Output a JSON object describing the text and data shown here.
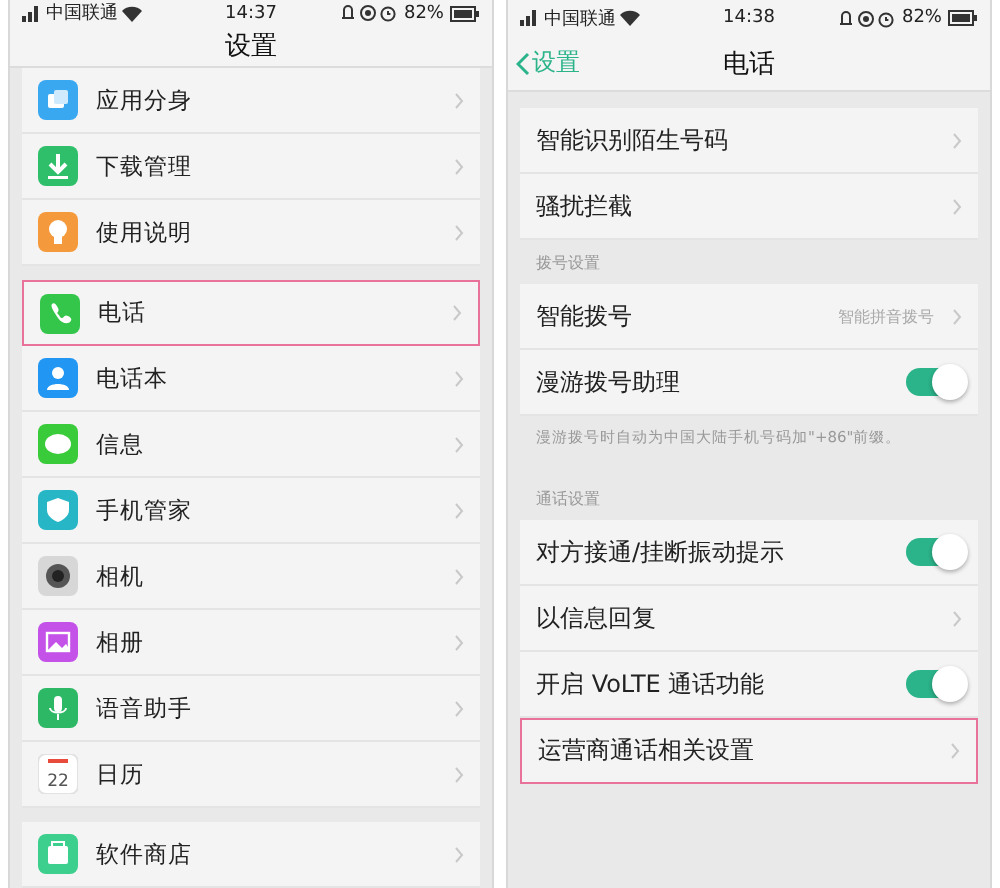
{
  "screens": [
    {
      "status_bar": {
        "carrier": "中国联通",
        "time": "14:37",
        "battery": "82%"
      },
      "header": {
        "title": "设置"
      },
      "sections": [
        {
          "rows": [
            {
              "kind": "app",
              "label": "应用分身",
              "highlighted": false
            },
            {
              "kind": "app",
              "label": "下载管理",
              "highlighted": false
            },
            {
              "kind": "app",
              "label": "使用说明",
              "highlighted": false
            }
          ]
        },
        {
          "rows": [
            {
              "kind": "app",
              "label": "电话",
              "highlighted": true
            },
            {
              "kind": "app",
              "label": "电话本",
              "highlighted": false
            },
            {
              "kind": "app",
              "label": "信息",
              "highlighted": false
            },
            {
              "kind": "app",
              "label": "手机管家",
              "highlighted": false
            },
            {
              "kind": "app",
              "label": "相机",
              "highlighted": false
            },
            {
              "kind": "app",
              "label": "相册",
              "highlighted": false
            },
            {
              "kind": "app",
              "label": "语音助手",
              "highlighted": false
            },
            {
              "kind": "app",
              "icon_text": "22",
              "label": "日历",
              "highlighted": false
            }
          ]
        },
        {
          "rows": [
            {
              "kind": "app",
              "label": "软件商店",
              "highlighted": false
            }
          ]
        }
      ]
    },
    {
      "status_bar": {
        "carrier": "中国联通",
        "time": "14:38",
        "battery": "82%"
      },
      "header": {
        "title": "电话",
        "back": "设置"
      },
      "sections": [
        {
          "rows": [
            {
              "kind": "link",
              "label": "智能识别陌生号码",
              "highlighted": false
            },
            {
              "kind": "link",
              "label": "骚扰拦截",
              "highlighted": false
            }
          ]
        },
        {
          "label": "拨号设置",
          "rows": [
            {
              "kind": "value",
              "label": "智能拨号",
              "value": "智能拼音拨号",
              "highlighted": false
            },
            {
              "kind": "toggle",
              "label": "漫游拨号助理",
              "on": true,
              "highlighted": false
            }
          ],
          "note": "漫游拨号时自动为中国大陆手机号码加\"+86\"前缀。"
        },
        {
          "label": "通话设置",
          "rows": [
            {
              "kind": "toggle",
              "label": "对方接通/挂断振动提示",
              "on": true,
              "highlighted": false
            },
            {
              "kind": "link",
              "label": "以信息回复",
              "highlighted": false
            },
            {
              "kind": "toggle",
              "label": "开启 VoLTE 通话功能",
              "on": true,
              "highlighted": false
            },
            {
              "kind": "link",
              "label": "运营商通话相关设置",
              "highlighted": true
            }
          ]
        }
      ]
    }
  ]
}
